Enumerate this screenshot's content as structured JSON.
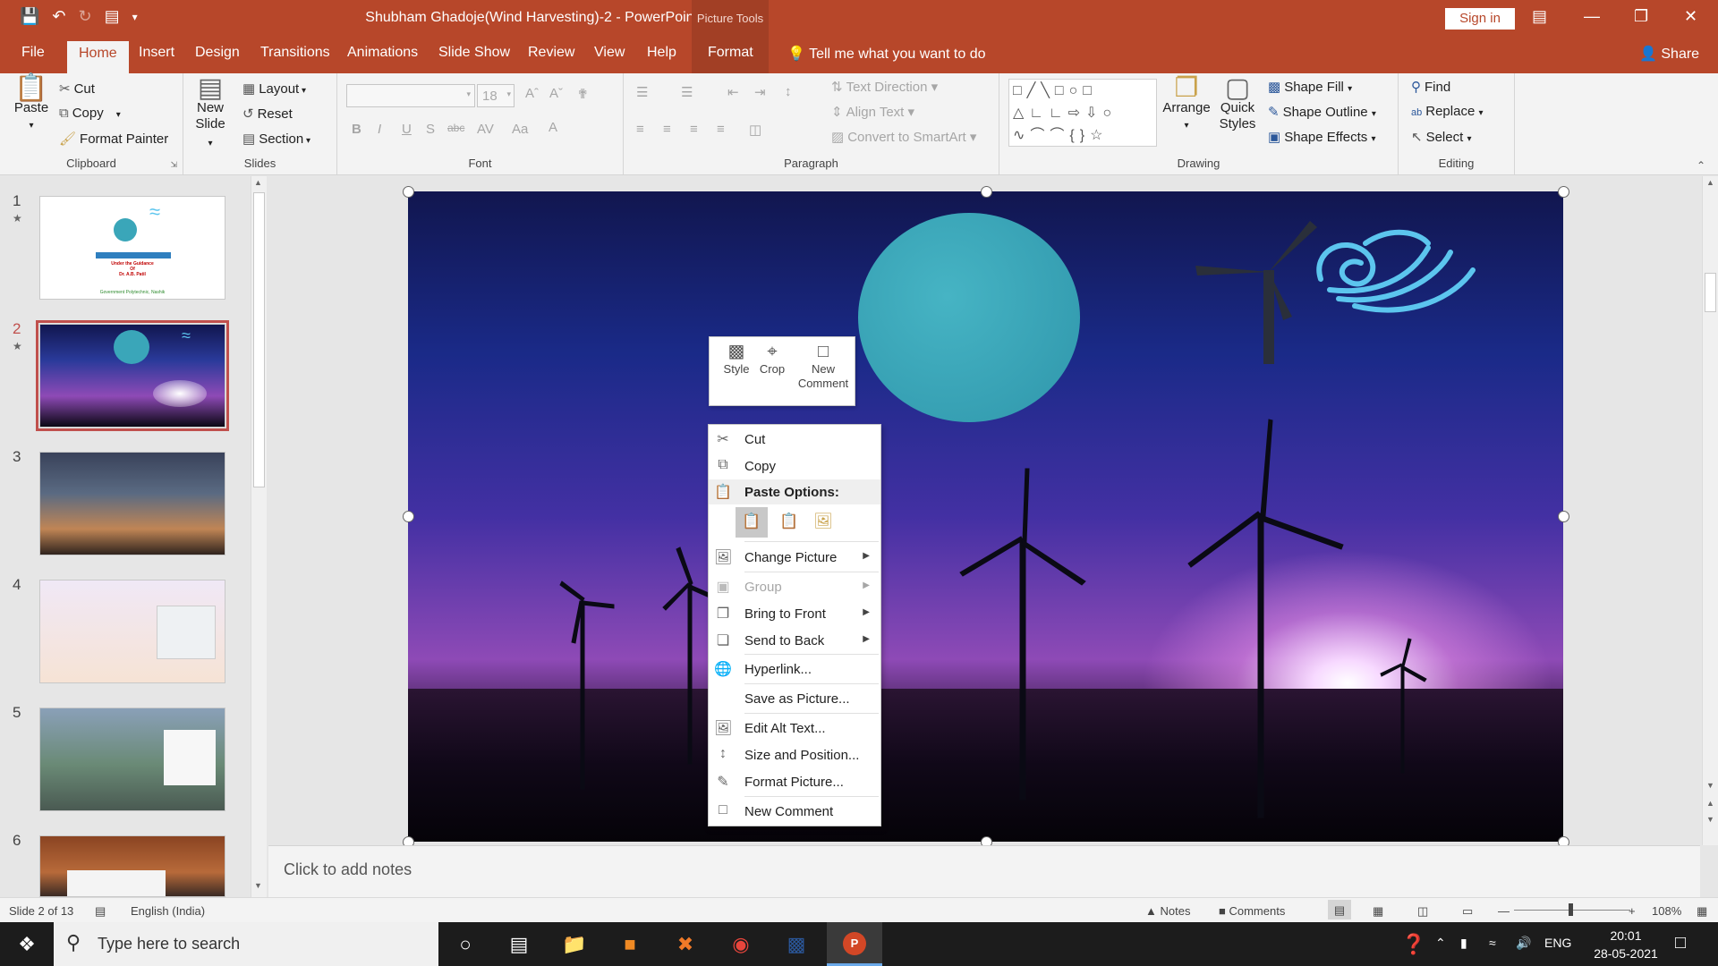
{
  "window": {
    "title": "Shubham Ghadoje(Wind Harvesting)-2  -  PowerPoint",
    "context_tab_group": "Picture Tools",
    "sign_in": "Sign in"
  },
  "tabs": [
    "File",
    "Home",
    "Insert",
    "Design",
    "Transitions",
    "Animations",
    "Slide Show",
    "Review",
    "View",
    "Help",
    "Format"
  ],
  "tell_me": "Tell me what you want to do",
  "share": "Share",
  "ribbon": {
    "clipboard": {
      "label": "Clipboard",
      "paste": "Paste",
      "cut": "Cut",
      "copy": "Copy",
      "format_painter": "Format Painter"
    },
    "slides": {
      "label": "Slides",
      "new_slide_1": "New",
      "new_slide_2": "Slide",
      "layout": "Layout",
      "reset": "Reset",
      "section": "Section"
    },
    "font": {
      "label": "Font",
      "font_size": "18"
    },
    "paragraph": {
      "label": "Paragraph",
      "text_direction": "Text Direction",
      "align_text": "Align Text",
      "convert_smartart": "Convert to SmartArt"
    },
    "drawing": {
      "label": "Drawing",
      "arrange": "Arrange",
      "quick_styles_1": "Quick",
      "quick_styles_2": "Styles",
      "shape_fill": "Shape Fill",
      "shape_outline": "Shape Outline",
      "shape_effects": "Shape Effects"
    },
    "editing": {
      "label": "Editing",
      "find": "Find",
      "replace": "Replace",
      "select": "Select"
    }
  },
  "slide_numbers": [
    "1",
    "2",
    "3",
    "4",
    "5",
    "6"
  ],
  "thumb1": {
    "subtitle_lines": [
      "Under the Guidance",
      "Of",
      "Dr. A.B. Patil"
    ],
    "footer": "Government Polytechnic, Nashik"
  },
  "mini_toolbar": {
    "style": "Style",
    "crop": "Crop",
    "new_comment_1": "New",
    "new_comment_2": "Comment"
  },
  "context_menu": {
    "cut": "Cut",
    "copy": "Copy",
    "paste_options": "Paste Options:",
    "change_picture": "Change Picture",
    "group": "Group",
    "bring_to_front": "Bring to Front",
    "send_to_back": "Send to Back",
    "hyperlink": "Hyperlink...",
    "save_as_picture": "Save as Picture...",
    "edit_alt_text": "Edit Alt Text...",
    "size_and_position": "Size and Position...",
    "format_picture": "Format Picture...",
    "new_comment": "New Comment"
  },
  "notes_placeholder": "Click to add notes",
  "status": {
    "slide_info": "Slide 2 of 13",
    "language": "English (India)",
    "notes": "Notes",
    "comments": "Comments",
    "zoom": "108%"
  },
  "taskbar": {
    "search_placeholder": "Type here to search",
    "lang": "ENG",
    "time": "20:01",
    "date": "28-05-2021"
  },
  "colors": {
    "accent": "#b7472a",
    "selection": "#c0504d",
    "circle": "#3aa6b9",
    "wind_swirl": "#5cc5ee"
  }
}
